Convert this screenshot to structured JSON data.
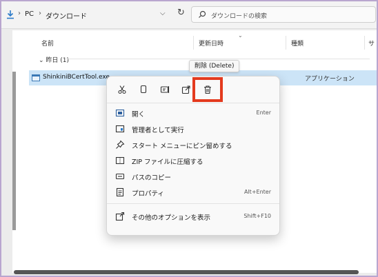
{
  "address_bar": {
    "crumbs": [
      "PC",
      "ダウンロード"
    ],
    "search_placeholder": "ダウンロードの検索"
  },
  "columns": [
    "名前",
    "更新日時",
    "種類",
    "サ"
  ],
  "group_label": "昨日 (1)",
  "file": {
    "name": "ShinkiniBCertTool.exe",
    "type": "アプリケーション"
  },
  "tooltip": "削除 (Delete)",
  "menu": {
    "icons": [
      "cut-icon",
      "copy-icon",
      "rename-icon",
      "share-icon",
      "delete-icon"
    ],
    "items": [
      {
        "label": "開く",
        "shortcut": "Enter"
      },
      {
        "label": "管理者として実行",
        "shortcut": ""
      },
      {
        "label": "スタート メニューにピン留めする",
        "shortcut": ""
      },
      {
        "label": "ZIP ファイルに圧縮する",
        "shortcut": ""
      },
      {
        "label": "パスのコピー",
        "shortcut": ""
      },
      {
        "label": "プロパティ",
        "shortcut": "Alt+Enter"
      },
      {
        "label": "その他のオプションを表示",
        "shortcut": "Shift+F10"
      }
    ]
  },
  "colors": {
    "highlight": "#e43a1e",
    "selection": "#cce4f7",
    "frame": "#b9a6cf"
  }
}
